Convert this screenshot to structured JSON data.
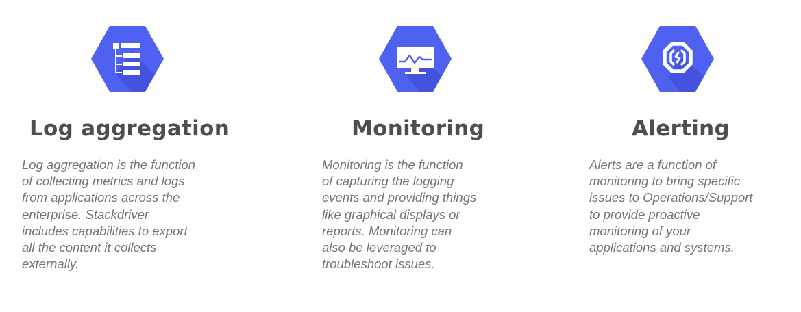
{
  "colors": {
    "hex_fill": "#4f61f0",
    "hex_shadow": "#3a49d0",
    "title_text": "#4e4e4e",
    "desc_text": "#757575"
  },
  "features": [
    {
      "icon": "log-tree-icon",
      "title": "Log aggregation",
      "description_lines": [
        "Log aggregation is the function",
        "of collecting metrics and logs",
        "from applications across the",
        "enterprise. Stackdriver",
        "includes capabilities to export",
        "all the content it collects",
        "externally."
      ]
    },
    {
      "icon": "monitor-chart-icon",
      "title": "Monitoring",
      "description_lines": [
        "Monitoring is the function",
        "of capturing the logging",
        "events and providing things",
        "like graphical displays or",
        "reports. Monitoring can",
        "also be leveraged to",
        "troubleshoot issues."
      ]
    },
    {
      "icon": "alert-octagon-icon",
      "title": "Alerting",
      "description_lines": [
        "Alerts are a function of",
        "monitoring to bring specific",
        "issues to Operations/Support",
        "to provide proactive",
        "monitoring of your",
        "applications and systems."
      ]
    }
  ]
}
